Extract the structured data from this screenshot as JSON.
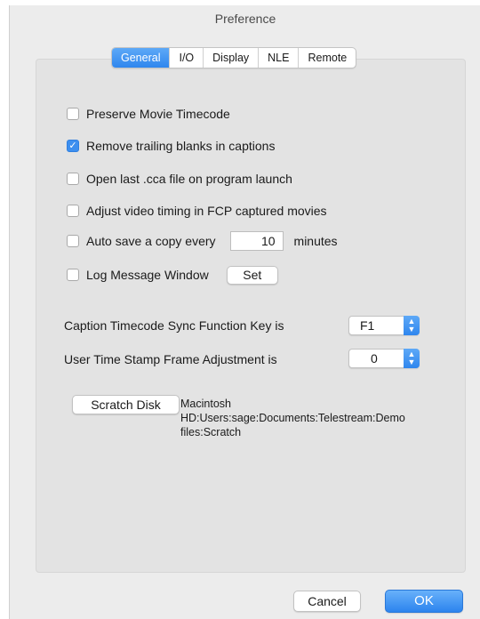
{
  "window": {
    "title": "Preference"
  },
  "tabs": [
    {
      "label": "General",
      "active": true
    },
    {
      "label": "I/O",
      "active": false
    },
    {
      "label": "Display",
      "active": false
    },
    {
      "label": "NLE",
      "active": false
    },
    {
      "label": "Remote",
      "active": false
    }
  ],
  "options": {
    "preserve_timecode": {
      "label": "Preserve Movie Timecode",
      "checked": false
    },
    "remove_trailing": {
      "label": "Remove trailing blanks in captions",
      "checked": true
    },
    "open_last": {
      "label": "Open last .cca file on program launch",
      "checked": false
    },
    "adjust_timing": {
      "label": "Adjust video timing in FCP captured movies",
      "checked": false
    },
    "auto_save": {
      "label": "Auto save a copy every",
      "checked": false,
      "value": "10",
      "unit": "minutes"
    },
    "log_window": {
      "label": "Log Message Window",
      "checked": false,
      "button": "Set"
    }
  },
  "sync_key": {
    "label": "Caption Timecode Sync Function Key is",
    "value": "F1"
  },
  "frame_adjust": {
    "label": "User Time Stamp Frame Adjustment is",
    "value": "0"
  },
  "scratch": {
    "button": "Scratch Disk",
    "path_line1": "Macintosh",
    "path_line2": "HD:Users:sage:Documents:Telestream:Demo",
    "path_line3": "files:Scratch"
  },
  "footer": {
    "cancel": "Cancel",
    "ok": "OK"
  },
  "colors": {
    "accent": "#2f86ee",
    "panel": "#e3e3e3",
    "window": "#ececec"
  }
}
